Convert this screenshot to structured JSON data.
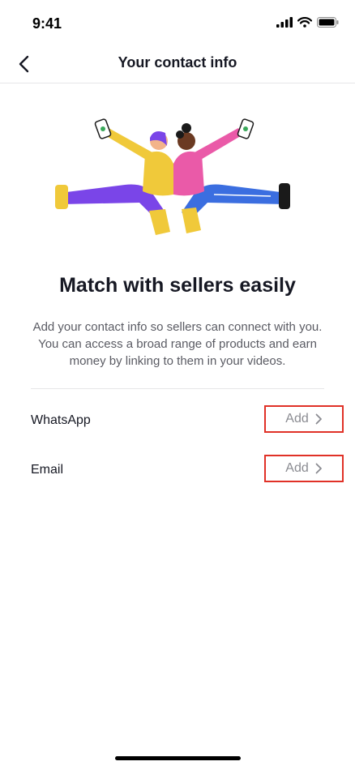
{
  "status_bar": {
    "time": "9:41",
    "signal_icon": "cellular-signal-icon",
    "wifi_icon": "wifi-icon",
    "battery_icon": "battery-icon"
  },
  "nav": {
    "back_icon": "chevron-left-icon",
    "title": "Your contact info"
  },
  "illustration": {
    "name": "two-people-with-phones-illustration"
  },
  "headline": "Match with sellers easily",
  "description": "Add your contact info so sellers can connect with you. You can access a broad range of products and earn money by linking to them in your videos.",
  "contacts": [
    {
      "label": "WhatsApp",
      "action": "Add",
      "action_icon": "chevron-right-icon"
    },
    {
      "label": "Email",
      "action": "Add",
      "action_icon": "chevron-right-icon"
    }
  ],
  "colors": {
    "highlight_border": "#e03127",
    "text_primary": "#161823",
    "text_secondary": "#5a5b63",
    "action_text": "#8a8b91"
  }
}
